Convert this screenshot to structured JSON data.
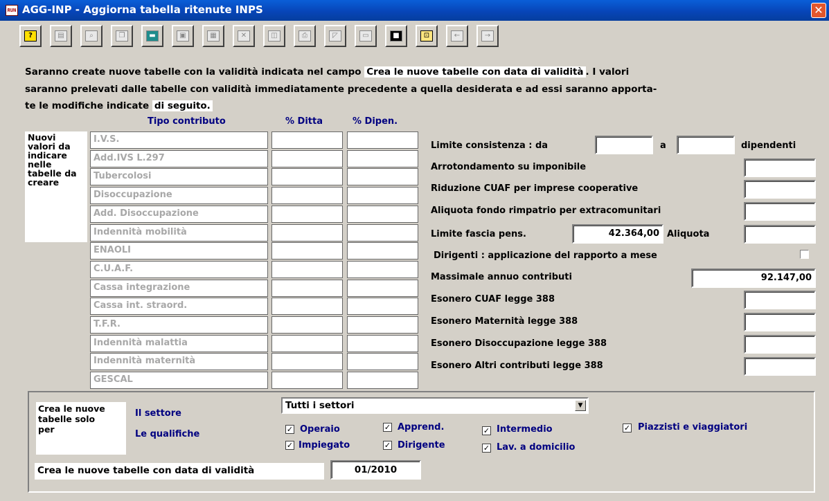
{
  "window": {
    "app_icon_text": "RUN",
    "title": "AGG-INP - Aggiorna tabella ritenute INPS",
    "close_symbol": "✕"
  },
  "toolbar": {
    "buttons": [
      {
        "name": "help-button",
        "icon": "question-icon",
        "glyph": "?"
      },
      {
        "name": "properties-button",
        "icon": "properties-icon",
        "glyph": "▤"
      },
      {
        "name": "search-button",
        "icon": "binoculars-icon",
        "glyph": "⌕"
      },
      {
        "name": "copy-button",
        "icon": "copy-icon",
        "glyph": "❐"
      },
      {
        "name": "calculator-button",
        "icon": "calculator-icon",
        "glyph": "▬"
      },
      {
        "name": "paste-button",
        "icon": "paste-icon",
        "glyph": "▣"
      },
      {
        "name": "grid-button",
        "icon": "grid-icon",
        "glyph": "▦"
      },
      {
        "name": "delete-button",
        "icon": "delete-icon",
        "glyph": "✕"
      },
      {
        "name": "preview-button",
        "icon": "preview-icon",
        "glyph": "◫"
      },
      {
        "name": "print-button",
        "icon": "print-icon",
        "glyph": "⎙"
      },
      {
        "name": "export-button",
        "icon": "export-icon",
        "glyph": "◸"
      },
      {
        "name": "form-button",
        "icon": "form-icon",
        "glyph": "▭"
      },
      {
        "name": "save-button",
        "icon": "floppy-icon",
        "glyph": "■"
      },
      {
        "name": "exit-button",
        "icon": "exit-icon",
        "glyph": "⊡"
      },
      {
        "name": "prev-button",
        "icon": "arrow-left-icon",
        "glyph": "←"
      },
      {
        "name": "next-button",
        "icon": "arrow-right-icon",
        "glyph": "→"
      }
    ]
  },
  "description": {
    "line1_a": "Saranno create nuove tabelle con la validità indicata nel campo",
    "line1_hl": "Crea le nuove tabelle con data di validità",
    "line1_b": ". I valori",
    "line2": "saranno prelevati dalle tabelle con validità immediatamente precedente a quella desiderata e ad essi saranno apporta-",
    "line3_a": "te le modifiche indicate",
    "line3_hl": "di seguito."
  },
  "table": {
    "side_label": "Nuovi valori da indicare nelle tabelle da creare",
    "headers": {
      "tipo": "Tipo contributo",
      "ditta": "% Ditta",
      "dipen": "% Dipen."
    },
    "rows": [
      "I.V.S.",
      "Add.IVS L.297",
      "Tubercolosi",
      "Disoccupazione",
      "Add. Disoccupazione",
      "Indennità mobilità",
      "ENAOLI",
      "C.U.A.F.",
      "Cassa integrazione",
      "Cassa int. straord.",
      "T.F.R.",
      "Indennità malattia",
      "Indennità maternità",
      "GESCAL"
    ]
  },
  "right": {
    "limite_consistenza": "Limite consistenza : da",
    "a": "a",
    "dipendenti": "dipendenti",
    "arrotondamento": "Arrotondamento su imponibile",
    "riduzione_cuaf": "Riduzione CUAF per imprese cooperative",
    "aliquota_fondo": "Aliquota fondo rimpatrio per extracomunitari",
    "limite_fascia": "Limite fascia pens.",
    "limite_fascia_value": "42.364,00",
    "aliquota": "Aliquota",
    "dirigenti": "Dirigenti : applicazione del rapporto a mese",
    "massimale": "Massimale annuo contributi",
    "massimale_value": "92.147,00",
    "esonero_cuaf": "Esonero CUAF legge 388",
    "esonero_maternita": "Esonero Maternità legge 388",
    "esonero_disoccupazione": "Esonero Disoccupazione legge 388",
    "esonero_altri": "Esonero Altri contributi legge 388"
  },
  "bottom": {
    "crea_label": "Crea le nuove tabelle solo per",
    "settore_label": "Il settore",
    "settore_value": "Tutti i settori",
    "qualifiche_label": "Le qualifiche",
    "checkboxes": {
      "operaio": "Operaio",
      "impiegato": "Impiegato",
      "apprend": "Apprend.",
      "dirigente": "Dirigente",
      "intermedio": "Intermedio",
      "lav_domicilio": "Lav. a domicilio",
      "piazzisti": "Piazzisti e viaggiatori"
    },
    "check_mark": "✓",
    "data_label": "Crea le nuove tabelle con data di validità",
    "data_value": "01/2010"
  }
}
